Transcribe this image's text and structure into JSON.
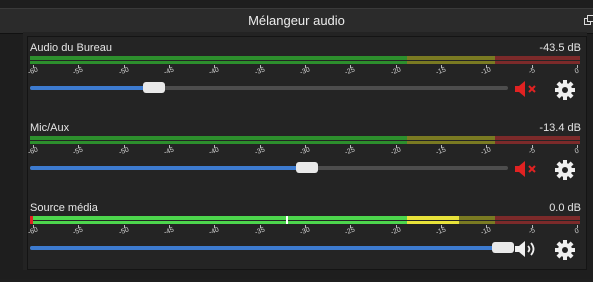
{
  "dock": {
    "title": "Mélangeur audio"
  },
  "scale": {
    "labels": [
      "-60",
      "-55",
      "-50",
      "-45",
      "-40",
      "-35",
      "-30",
      "-25",
      "-20",
      "-15",
      "-10",
      "-5",
      "0"
    ]
  },
  "channels": [
    {
      "name": "Audio du Bureau",
      "level_db": "-43.5 dB",
      "volume_fraction": 0.26,
      "muted": true,
      "meter_fraction": 0
    },
    {
      "name": "Mic/Aux",
      "level_db": "-13.4 dB",
      "volume_fraction": 0.58,
      "muted": true,
      "meter_fraction": 0
    },
    {
      "name": "Source média",
      "level_db": "0.0 dB",
      "volume_fraction": 0.99,
      "muted": false,
      "meter_fraction": 0.78
    }
  ],
  "colors": {
    "meter_green": "#2d8f2d",
    "meter_yellow": "#7a7a22",
    "meter_red": "#7c2a2a",
    "active_green": "#4dd64d",
    "active_yellow": "#e8e23a",
    "slider_fill": "#3d7bd0",
    "mute_red": "#e12222",
    "icon_white": "#f0f0f0"
  },
  "icons": {
    "muted": "speaker-muted-icon",
    "unmuted": "speaker-volume-icon",
    "settings": "gear-icon"
  }
}
